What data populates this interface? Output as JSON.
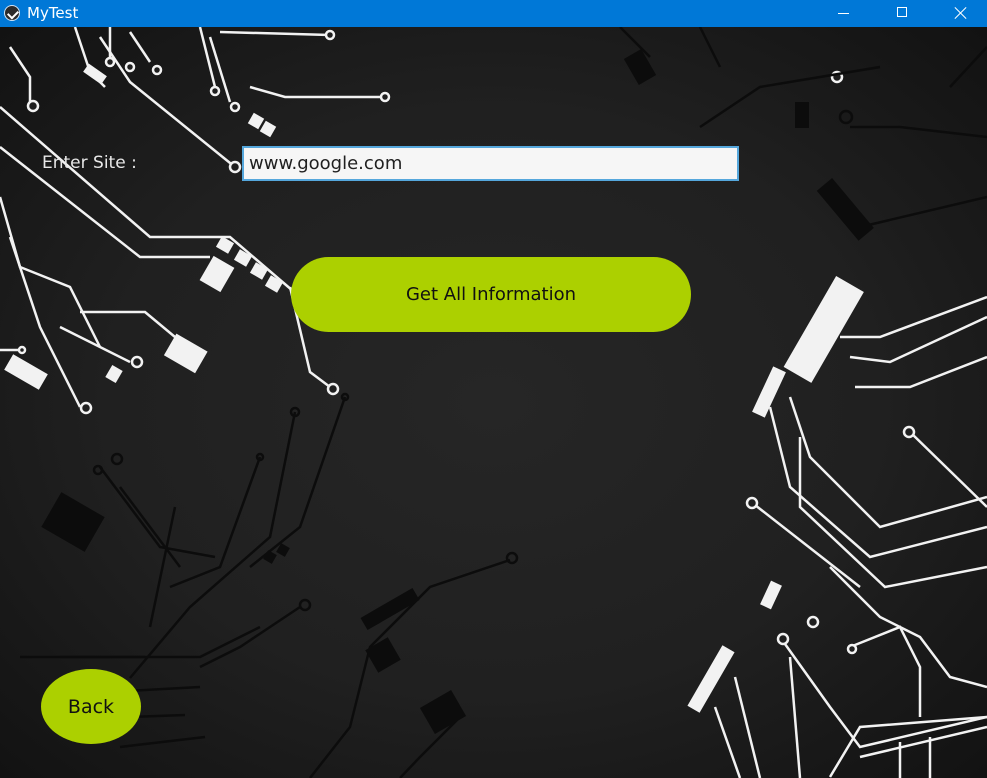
{
  "window": {
    "title": "MyTest",
    "controls": {
      "minimize": "minimize-icon",
      "maximize": "maximize-icon",
      "close": "close-icon"
    }
  },
  "form": {
    "site_label": "Enter Site :",
    "site_value": "www.google.com",
    "get_info_label": "Get All Information",
    "back_label": "Back"
  },
  "colors": {
    "titlebar": "#0078d7",
    "button_accent": "#acd000",
    "input_border": "#55a7dc",
    "background": "#1f1f1f"
  }
}
